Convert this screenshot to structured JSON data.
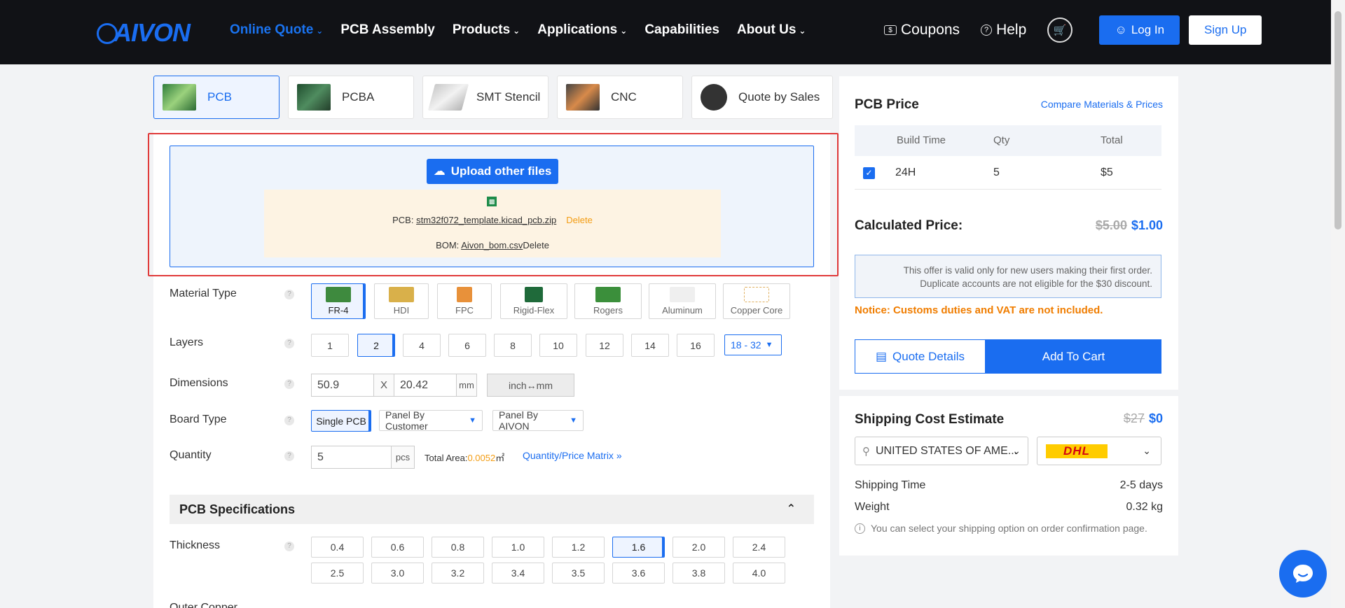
{
  "header": {
    "logo": "AIVON",
    "nav": [
      {
        "label": "Online Quote",
        "dropdown": true,
        "active": true
      },
      {
        "label": "PCB Assembly",
        "dropdown": false
      },
      {
        "label": "Products",
        "dropdown": true
      },
      {
        "label": "Applications",
        "dropdown": true
      },
      {
        "label": "Capabilities",
        "dropdown": false
      },
      {
        "label": "About Us",
        "dropdown": true
      }
    ],
    "coupons": "Coupons",
    "help": "Help",
    "login": "Log In",
    "signup": "Sign Up"
  },
  "tabs": [
    "PCB",
    "PCBA",
    "SMT Stencil",
    "CNC",
    "Quote by Sales"
  ],
  "upload": {
    "button": "Upload other files",
    "pcb_label": "PCB: ",
    "pcb_file": "stm32f072_template.kicad_pcb.zip",
    "pcb_delete": "Delete",
    "bom_label": "BOM: ",
    "bom_file": "Aivon_bom.csv",
    "bom_delete": "Delete"
  },
  "form": {
    "material_label": "Material Type",
    "materials": [
      "FR-4",
      "HDI",
      "FPC",
      "Rigid-Flex",
      "Rogers",
      "Aluminum",
      "Copper Core"
    ],
    "layers_label": "Layers",
    "layers": [
      "1",
      "2",
      "4",
      "6",
      "8",
      "10",
      "12",
      "14",
      "16"
    ],
    "layers_more": "18 - 32",
    "dimensions_label": "Dimensions",
    "dim_x": "50.9",
    "dim_sep": "X",
    "dim_y": "20.42",
    "dim_unit": "mm",
    "dim_toggle": "inch↔mm",
    "boardtype_label": "Board Type",
    "boardtype_single": "Single PCB",
    "boardtype_customer": "Panel By Customer",
    "boardtype_aivon": "Panel By AIVON",
    "quantity_label": "Quantity",
    "quantity_value": "5",
    "quantity_unit": "pcs",
    "total_area_label": "Total Area:",
    "total_area_value": "0.0052",
    "total_area_unit": "㎡",
    "matrix_link": "Quantity/Price Matrix »",
    "spec_title": "PCB Specifications",
    "thickness_label": "Thickness",
    "thickness_row1": [
      "0.4",
      "0.6",
      "0.8",
      "1.0",
      "1.2",
      "1.6",
      "2.0",
      "2.4"
    ],
    "thickness_row2": [
      "2.5",
      "3.0",
      "3.2",
      "3.4",
      "3.5",
      "3.6",
      "3.8",
      "4.0"
    ],
    "outer_copper_label": "Outer Copper"
  },
  "price": {
    "title": "PCB Price",
    "compare": "Compare Materials & Prices",
    "col_build": "Build Time",
    "col_qty": "Qty",
    "col_total": "Total",
    "row_build": "24H",
    "row_qty": "5",
    "row_total": "$5",
    "calc_label": "Calculated Price:",
    "old_price": "$5.00",
    "new_price": "$1.00",
    "offer_line1": "This offer is valid only for new users making their first order.",
    "offer_line2": "Duplicate accounts are not eligible for the $30 discount.",
    "notice": "Notice: Customs duties and VAT are not included.",
    "quote_details": "Quote Details",
    "add_to_cart": "Add To Cart"
  },
  "shipping": {
    "title": "Shipping Cost Estimate",
    "old_cost": "$27",
    "new_cost": "$0",
    "country": "UNITED STATES OF AME...",
    "carrier": "DHL",
    "time_label": "Shipping Time",
    "time_value": "2-5 days",
    "weight_label": "Weight",
    "weight_value": "0.32 kg",
    "info": "You can select your shipping option on order confirmation page."
  },
  "colors": {
    "accent": "#1a6df0",
    "header_bg": "#111216",
    "highlight_frame": "#e03a3a",
    "notice": "#f07d00"
  }
}
